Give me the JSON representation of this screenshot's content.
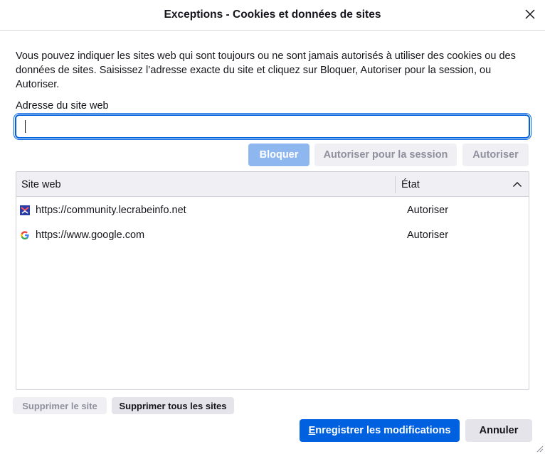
{
  "window": {
    "title": "Exceptions - Cookies et données de sites"
  },
  "description": "Vous pouvez indiquer les sites web qui sont toujours ou ne sont jamais autorisés à utiliser des cookies ou des données de sites. Saisissez l’adresse exacte du site et cliquez sur Bloquer, Autoriser pour la session, ou Autoriser.",
  "address": {
    "label": "Adresse du site web",
    "value": "",
    "placeholder": ""
  },
  "actions": {
    "block": "Bloquer",
    "allow_session": "Autoriser pour la session",
    "allow": "Autoriser"
  },
  "table": {
    "columns": {
      "site": "Site web",
      "state": "État"
    },
    "rows": [
      {
        "site": "https://community.lecrabeinfo.net",
        "state": "Autoriser",
        "icon": "lecrabeinfo-favicon-icon"
      },
      {
        "site": "https://www.google.com",
        "state": "Autoriser",
        "icon": "google-favicon-icon"
      }
    ]
  },
  "footer": {
    "remove_site": "Supprimer le site",
    "remove_all": "Supprimer tous les sites",
    "save_access_key": "E",
    "save_rest": "nregistrer les modifications",
    "cancel": "Annuler"
  },
  "colors": {
    "accent": "#0061e0",
    "disabled_primary": "#8fb7ef",
    "button_bg": "#f0f0f4"
  }
}
